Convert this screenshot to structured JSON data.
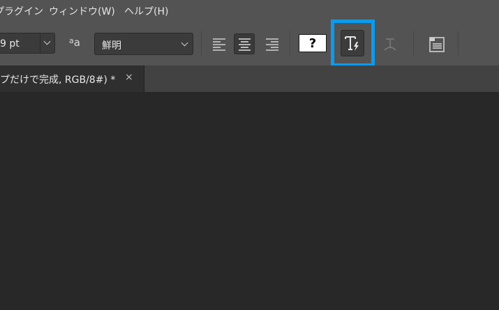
{
  "menubar": {
    "items": [
      {
        "label": "プラグイン"
      },
      {
        "label": "ウィンドウ(W)"
      },
      {
        "label": "ヘルプ(H)"
      }
    ]
  },
  "options_bar": {
    "font_size": {
      "value": "9 pt"
    },
    "anti_alias_icon": "aa-icon",
    "anti_alias": {
      "value": "鮮明"
    },
    "align_buttons": [
      {
        "name": "align-left",
        "active": false
      },
      {
        "name": "align-center",
        "active": true
      },
      {
        "name": "align-right",
        "active": false
      }
    ],
    "text_color": {
      "glyph": "?",
      "color": "#ffffff"
    },
    "highlight_color": "#0a9bf0",
    "buttons": {
      "highlighted": "text-lightning-icon",
      "warp": "warp-text-icon",
      "panels": "character-panel-icon"
    }
  },
  "tab": {
    "label": "プだけで完成, RGB/8#) *",
    "close": "×"
  }
}
